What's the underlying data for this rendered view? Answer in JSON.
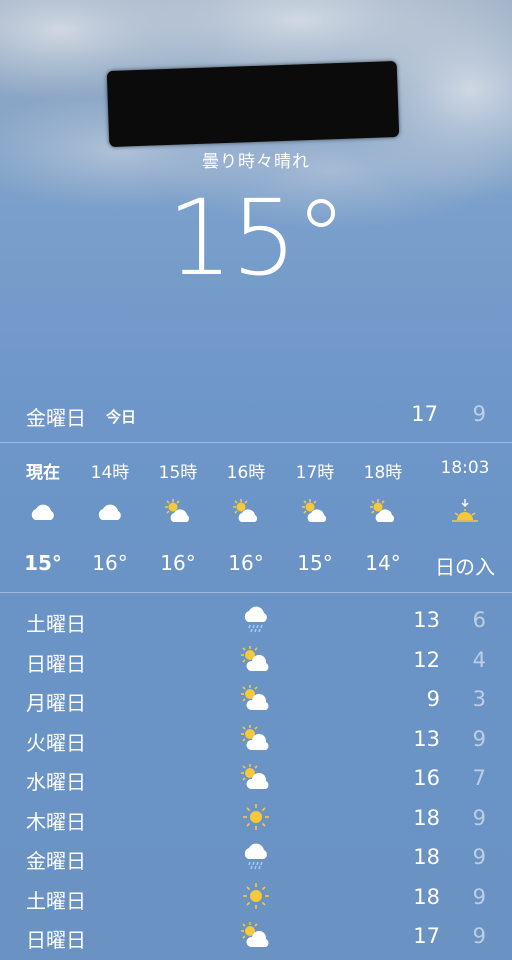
{
  "header": {
    "condition": "曇り時々晴れ",
    "current_temp": "15°"
  },
  "today": {
    "day": "金曜日",
    "tag": "今日",
    "high": "17",
    "low": "9"
  },
  "hourly": [
    {
      "label": "現在",
      "icon": "cloud-icon",
      "temp": "15°"
    },
    {
      "label": "14時",
      "icon": "cloud-icon",
      "temp": "16°"
    },
    {
      "label": "15時",
      "icon": "partly-cloudy-icon",
      "temp": "16°"
    },
    {
      "label": "16時",
      "icon": "partly-cloudy-icon",
      "temp": "16°"
    },
    {
      "label": "17時",
      "icon": "partly-cloudy-icon",
      "temp": "15°"
    },
    {
      "label": "18時",
      "icon": "partly-cloudy-icon",
      "temp": "14°"
    },
    {
      "label": "18:03",
      "icon": "sunset-icon",
      "temp": "日の入"
    }
  ],
  "daily": [
    {
      "day": "土曜日",
      "icon": "rain-icon",
      "high": "13",
      "low": "6"
    },
    {
      "day": "日曜日",
      "icon": "partly-cloudy-icon",
      "high": "12",
      "low": "4"
    },
    {
      "day": "月曜日",
      "icon": "partly-cloudy-icon",
      "high": "9",
      "low": "3"
    },
    {
      "day": "火曜日",
      "icon": "partly-cloudy-icon",
      "high": "13",
      "low": "9"
    },
    {
      "day": "水曜日",
      "icon": "partly-cloudy-icon",
      "high": "16",
      "low": "7"
    },
    {
      "day": "木曜日",
      "icon": "sun-icon",
      "high": "18",
      "low": "9"
    },
    {
      "day": "金曜日",
      "icon": "rain-icon",
      "high": "18",
      "low": "9"
    },
    {
      "day": "土曜日",
      "icon": "sun-icon",
      "high": "18",
      "low": "9"
    },
    {
      "day": "日曜日",
      "icon": "partly-cloudy-icon",
      "high": "17",
      "low": "9"
    }
  ],
  "colors": {
    "sun": "#f6c83a",
    "text_dim": "rgba(255,255,255,0.55)"
  }
}
